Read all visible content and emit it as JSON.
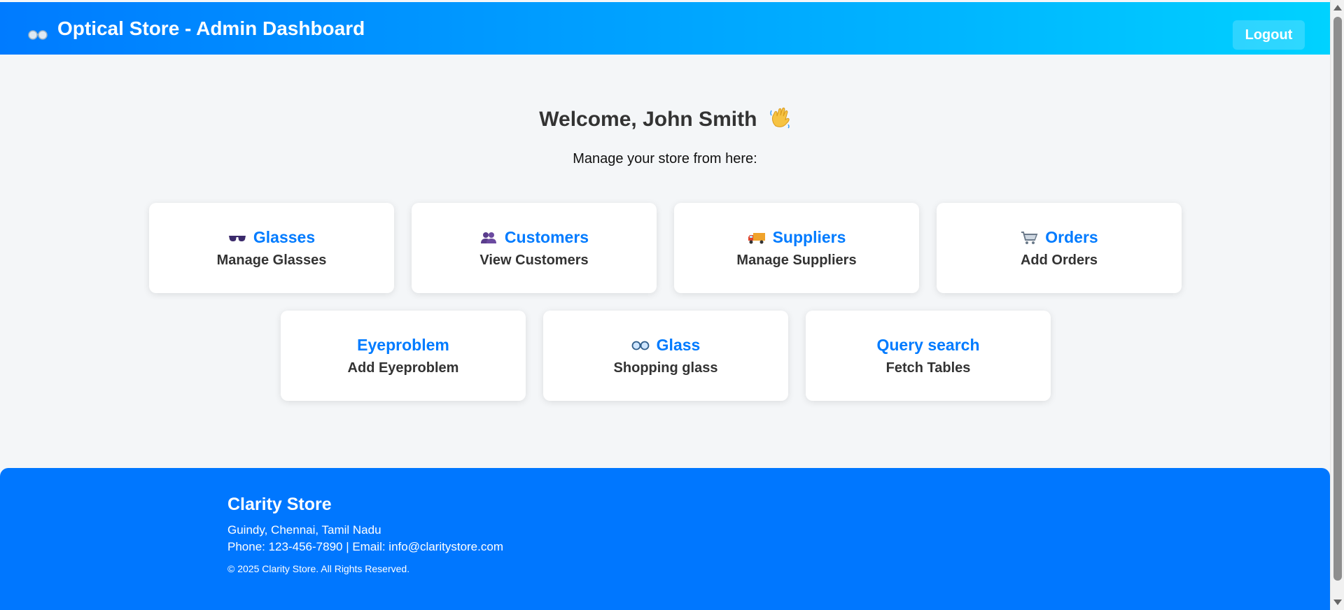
{
  "header": {
    "brand_icon": "glasses-icon",
    "title": "Optical Store - Admin Dashboard",
    "logout_label": "Logout",
    "gradient_start": "#007bff",
    "gradient_end": "#00d2ff"
  },
  "welcome": {
    "heading": "Welcome, John Smith",
    "wave_icon": "waving-hand-icon",
    "subtitle": "Manage your store from here:"
  },
  "cards": [
    {
      "icon": "sunglasses-icon",
      "title": "Glasses",
      "subtitle": "Manage Glasses"
    },
    {
      "icon": "customers-icon",
      "title": "Customers",
      "subtitle": "View Customers"
    },
    {
      "icon": "delivery-truck-icon",
      "title": "Suppliers",
      "subtitle": "Manage Suppliers"
    },
    {
      "icon": "shopping-cart-icon",
      "title": "Orders",
      "subtitle": "Add Orders"
    },
    {
      "icon": "",
      "title": "Eyeproblem",
      "subtitle": "Add Eyeproblem"
    },
    {
      "icon": "glasses-icon",
      "title": "Glass",
      "subtitle": "Shopping glass"
    },
    {
      "icon": "",
      "title": "Query search",
      "subtitle": "Fetch Tables"
    }
  ],
  "footer": {
    "title": "Clarity Store",
    "address": "Guindy, Chennai, Tamil Nadu",
    "contact": "Phone: 123-456-7890 | Email: info@claritystore.com",
    "copyright": "© 2025 Clarity Store. All Rights Reserved."
  },
  "colors": {
    "accent": "#007bff",
    "footer_bg": "#0077ff",
    "page_bg": "#f4f6f8"
  }
}
